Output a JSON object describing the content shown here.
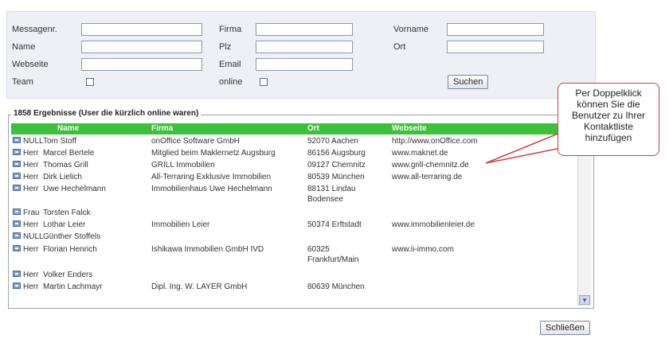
{
  "search_form": {
    "fields": {
      "messagenr_label": "Messagenr.",
      "name_label": "Name",
      "webseite_label": "Webseite",
      "team_label": "Team",
      "firma_label": "Firma",
      "plz_label": "Plz",
      "email_label": "Email",
      "online_label": "online",
      "vorname_label": "Vorname",
      "ort_label": "Ort"
    },
    "search_button": "Suchen"
  },
  "results": {
    "title": "1858 Ergebnisse (User die kürzlich online waren)",
    "columns": [
      "Name",
      "Firma",
      "Ort",
      "Webseite"
    ],
    "rows": [
      {
        "anrede": "NULL",
        "name": "Tom Stoff",
        "firma": "onOffice Software GmbH",
        "ort": "52070 Aachen",
        "web": "http://www.onOffice.com"
      },
      {
        "anrede": "Herr",
        "name": "Marcel Bertele",
        "firma": "Mitglied beim Maklernetz Augsburg",
        "ort": "86156 Augsburg",
        "web": "www.maknet.de"
      },
      {
        "anrede": "Herr",
        "name": "Thomas Grill",
        "firma": "GRILL Immobilien",
        "ort": "09127 Chemnitz",
        "web": "www.grill-chemnitz.de"
      },
      {
        "anrede": "Herr",
        "name": "Dirk Lielich",
        "firma": "All-Terraring Exklusive Immobilien",
        "ort": "80539 München",
        "web": "www.all-terraring.de"
      },
      {
        "anrede": "Herr",
        "name": "Uwe Hechelmann",
        "firma": "Immobilienhaus Uwe Hechelmann",
        "ort": "88131 Lindau Bodensee",
        "web": ""
      },
      {
        "anrede": "Frau",
        "name": "Torsten Falck",
        "firma": "",
        "ort": "",
        "web": ""
      },
      {
        "anrede": "Herr",
        "name": "Lothar Leier",
        "firma": "Immobilien Leier",
        "ort": "50374 Erftstadt",
        "web": "www.immobilienleier.de"
      },
      {
        "anrede": "NULL",
        "name": "Günther Stoffels",
        "firma": "",
        "ort": "",
        "web": ""
      },
      {
        "anrede": "Herr",
        "name": "Florian Henrich",
        "firma": "Ishikawa Immobilien GmbH IVD",
        "ort": "60325 Frankfurt/Main",
        "web": "www.ii-immo.com"
      },
      {
        "anrede": "Herr",
        "name": "Volker Enders",
        "firma": "",
        "ort": "",
        "web": ""
      },
      {
        "anrede": "Herr",
        "name": "Martin Lachmayr",
        "firma": "Dipl. Ing. W. LAYER GmbH",
        "ort": "80639 München",
        "web": ""
      }
    ]
  },
  "callout": {
    "text": "Per Doppelklick können Sie die Benutzer zu Ihrer Kontaktliste hinzufügen",
    "border_color": "#d23c3c"
  },
  "close_button": "Schließen",
  "colors": {
    "header_green": "#3cc23a"
  },
  "icons": {
    "row_icon": "user-card-icon",
    "scroll_down": "chevron-down-icon"
  }
}
